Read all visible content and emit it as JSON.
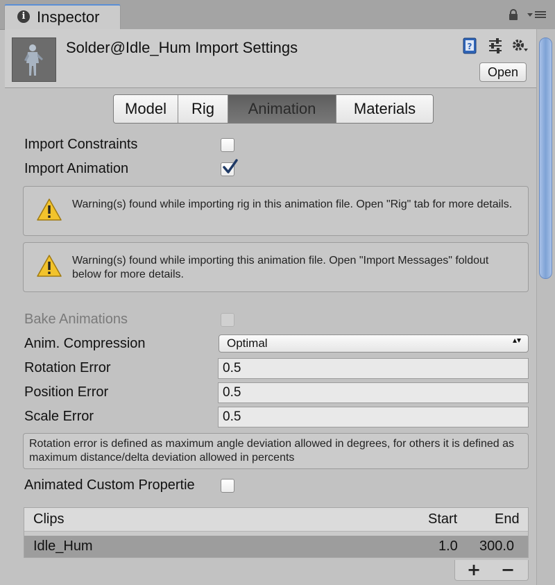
{
  "tab": {
    "icon": "info-icon",
    "label": "Inspector"
  },
  "header": {
    "title": "Solder@Idle_Hum Import Settings",
    "open_label": "Open",
    "icons": [
      "help-book-icon",
      "preset-sliders-icon",
      "settings-gear-icon"
    ]
  },
  "tabs": [
    {
      "label": "Model",
      "active": false
    },
    {
      "label": "Rig",
      "active": false
    },
    {
      "label": "Animation",
      "active": true
    },
    {
      "label": "Materials",
      "active": false
    }
  ],
  "import_constraints": {
    "label": "Import Constraints",
    "checked": false
  },
  "import_animation": {
    "label": "Import Animation",
    "checked": true
  },
  "warnings": [
    {
      "icon": "warning-icon",
      "text": "Warning(s) found while importing rig in this animation file. Open \"Rig\" tab for more details."
    },
    {
      "icon": "warning-icon",
      "text": "Warning(s) found while importing this animation file. Open \"Import Messages\" foldout below for more details."
    }
  ],
  "bake_animations": {
    "label": "Bake Animations",
    "checked": false,
    "disabled": true
  },
  "anim_compression": {
    "label": "Anim. Compression",
    "value": "Optimal",
    "arrow": "▴▾"
  },
  "rotation_error": {
    "label": "Rotation Error",
    "value": "0.5"
  },
  "position_error": {
    "label": "Position Error",
    "value": "0.5"
  },
  "scale_error": {
    "label": "Scale Error",
    "value": "0.5"
  },
  "info_text": "Rotation error is defined as maximum angle deviation allowed in degrees, for others it is defined as maximum distance/delta deviation allowed in percents",
  "animated_custom_properties": {
    "label": "Animated Custom Propertie",
    "checked": false
  },
  "clips": {
    "headers": {
      "clips": "Clips",
      "start": "Start",
      "end": "End"
    },
    "rows": [
      {
        "name": "Idle_Hum",
        "start": "1.0",
        "end": "300.0",
        "selected": true
      }
    ],
    "add_label": "+",
    "remove_label": "−"
  },
  "colors": {
    "accent": "#5a8fd6",
    "scroll_thumb": "#7ea2d6",
    "warning": "#f2c32c"
  }
}
